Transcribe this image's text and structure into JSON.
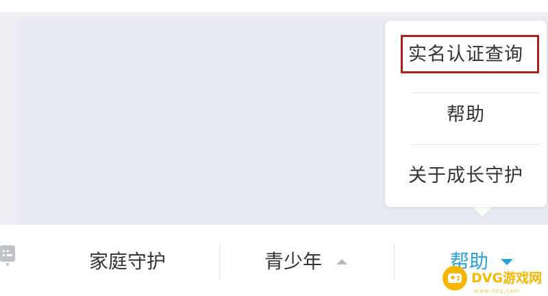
{
  "dropdown": {
    "items": [
      {
        "label": "实名认证查询",
        "highlighted": true
      },
      {
        "label": "帮助"
      },
      {
        "label": "关于成长守护"
      }
    ]
  },
  "bottom_nav": {
    "items": [
      {
        "label": "家庭守护"
      },
      {
        "label": "青少年",
        "caret": "up"
      },
      {
        "label": "帮助",
        "caret": "down",
        "active": true
      }
    ]
  },
  "watermark": {
    "text": "DVG游戏网",
    "sub": "www.dvg.com"
  },
  "colors": {
    "active": "#2aa3d6",
    "highlight_border": "#b01e1e",
    "watermark": "#f6b600",
    "background": "#e8ebf3"
  },
  "icons": [
    "keyboard-icon",
    "caret-up-icon",
    "caret-down-icon",
    "gamepad-icon"
  ]
}
